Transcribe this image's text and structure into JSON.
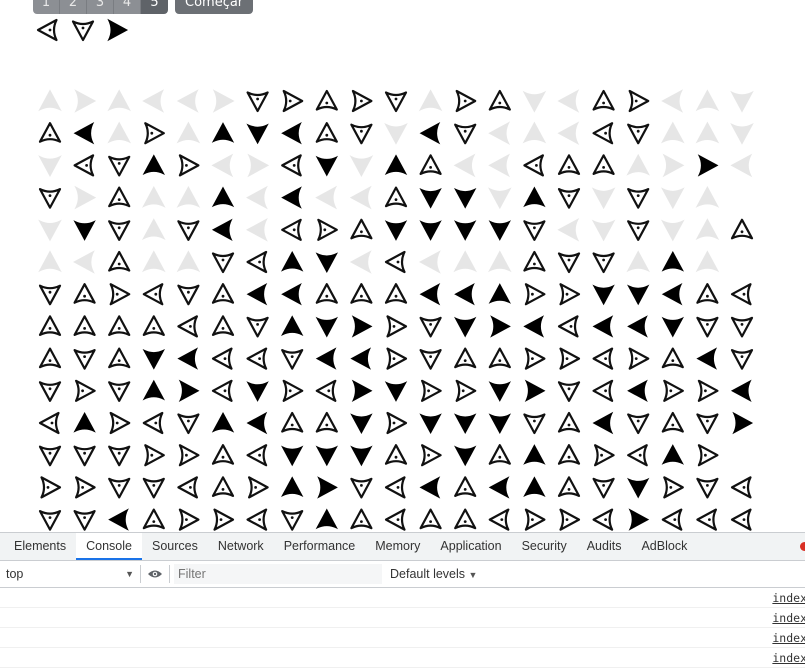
{
  "pager": {
    "pages": [
      "1",
      "2",
      "3",
      "4",
      "5"
    ],
    "start_label": "Começar"
  },
  "legend": [
    "left-outline-arrow-icon",
    "down-outline-arrow-icon",
    "right-filled-arrow-icon"
  ],
  "grid": {
    "cols": 21,
    "rows": 13,
    "codes": [
      "UAULLRDRUADUAUDLURLUDUALL",
      "ULURUUDLUDDLDLULLDUUD",
      "DLDURLRLDDUULLLUUURRL",
      "DRUUUULLLLUDDDUDDDDU",
      "DDDUDLLLRUDDDDDLDDDUU",
      "ULUUUDLUDLLLUUUDDUUU",
      "DURLDULLUUULLURRDDLUL",
      "UUUULUDUDRRDDRLLLLDDD",
      "UDUDLLLDLLRDUURRLRULD",
      "DRDURLDRLRDRRDRDLLRRL",
      "LURLDULUUDRDDDDULDUDR",
      "DDDRRULDDDURDUUURLUR",
      "RRDDLURURDLLULUUDDRDL",
      "DDLURRLDUULUULRRLRLLL"
    ],
    "styles": [
      "ggggggooooogooggoogggg",
      "ofgogfffoogfogggooggg",
      "golfoggofgfoggoooggfgg",
      "ogoggfgfggoffgfogogggo",
      "gfogofgoooffffoggoggoog",
      "ggoggooffgogggooogfgog",
      "ooooooffooofffoofffoof",
      "ooooooofffoofffofffoo",
      "oooffoooffooooooooofo",
      "oooffofooffooffoofoof",
      "ofoooffoofofffoofooofo",
      "ooooooofffoofofooofoo",
      "oooooooffoofoffoofooo",
      "oofooooofoooooooofoo"
    ]
  },
  "devtools": {
    "tabs": [
      "Elements",
      "Console",
      "Sources",
      "Network",
      "Performance",
      "Memory",
      "Application",
      "Security",
      "Audits",
      "AdBlock"
    ],
    "active_tab": "Console",
    "context": "top",
    "filter_placeholder": "Filter",
    "levels": "Default levels",
    "log_links": [
      "index",
      "index",
      "index",
      "index"
    ]
  }
}
